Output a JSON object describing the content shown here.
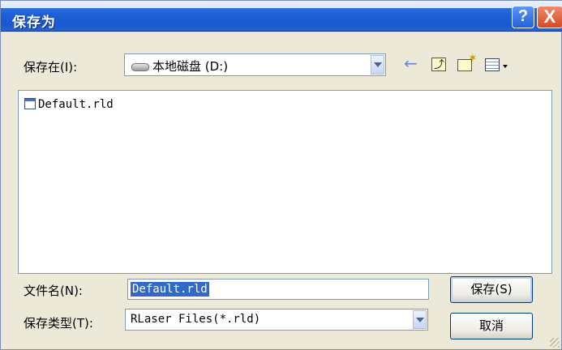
{
  "window": {
    "title": "保存为"
  },
  "title_buttons": {
    "help": "?",
    "close": "X"
  },
  "save_in": {
    "label": "保存在(I):",
    "value": "本地磁盘 (D:)",
    "icon": "drive-icon"
  },
  "toolbar": {
    "back": "←",
    "up": "⤴",
    "new_folder": "✶"
  },
  "files": [
    {
      "name": "Default.rld",
      "icon": "rld-file-icon"
    }
  ],
  "filename": {
    "label": "文件名(N):",
    "value": "Default.rld"
  },
  "filetype": {
    "label": "保存类型(T):",
    "value": "RLaser Files(*.rld)"
  },
  "buttons": {
    "save": "保存(S)",
    "cancel": "取消"
  },
  "colors": {
    "title_bar": "#1c5fd8",
    "selection": "#3169c6",
    "dialog_bg": "#ece9d8"
  }
}
